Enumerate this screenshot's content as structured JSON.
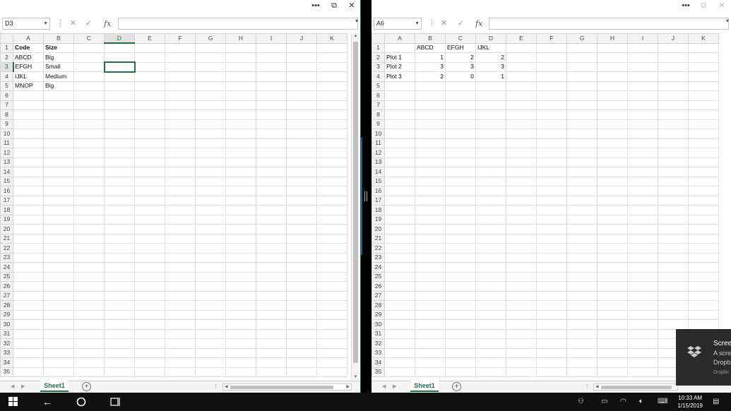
{
  "left_window": {
    "titlebar": {
      "more": "•••",
      "restore": "⧉",
      "close": "✕"
    },
    "namebox": "D3",
    "formula_value": "",
    "fx": "fx",
    "columns": [
      "A",
      "B",
      "C",
      "D",
      "E",
      "F",
      "G",
      "H",
      "I",
      "J",
      "K"
    ],
    "selected_column": "D",
    "selected_row": 3,
    "rows": [
      [
        "Code",
        "Size",
        "",
        "",
        "",
        "",
        "",
        "",
        "",
        "",
        ""
      ],
      [
        "ABCD",
        "Big",
        "",
        "",
        "",
        "",
        "",
        "",
        "",
        "",
        ""
      ],
      [
        "EFGH",
        "Small",
        "",
        "",
        "",
        "",
        "",
        "",
        "",
        "",
        ""
      ],
      [
        "IJKL",
        "Medium",
        "",
        "",
        "",
        "",
        "",
        "",
        "",
        "",
        ""
      ],
      [
        "MNOP",
        "Big",
        "",
        "",
        "",
        "",
        "",
        "",
        "",
        "",
        ""
      ]
    ],
    "row_count": 35,
    "sheet_tab": "Sheet1",
    "add_sheet": "+"
  },
  "right_window": {
    "titlebar": {
      "more": "•••",
      "restore": "⧉",
      "close": "✕"
    },
    "namebox": "A6",
    "formula_value": "",
    "fx": "fx",
    "columns": [
      "A",
      "B",
      "C",
      "D",
      "E",
      "F",
      "G",
      "H",
      "I",
      "J",
      "K"
    ],
    "rows": [
      [
        "",
        "ABCD",
        "EFGH",
        "IJKL",
        "",
        "",
        "",
        "",
        "",
        "",
        ""
      ],
      [
        "Plot 1",
        "1",
        "2",
        "2",
        "",
        "",
        "",
        "",
        "",
        "",
        ""
      ],
      [
        "Plot 2",
        "3",
        "3",
        "3",
        "",
        "",
        "",
        "",
        "",
        "",
        ""
      ],
      [
        "Plot 3",
        "2",
        "0",
        "1",
        "",
        "",
        "",
        "",
        "",
        "",
        ""
      ]
    ],
    "row_count": 35,
    "sheet_tab": "Sheet1",
    "add_sheet": "+"
  },
  "toast": {
    "title": "Scree",
    "line1": "A scre",
    "line2": "Dropb",
    "source": "Dropbc"
  },
  "taskbar": {
    "time": "10:33 AM",
    "date": "1/15/2019",
    "start_icon": "windows-logo-icon",
    "back_icon": "back-arrow-icon",
    "cortana_icon": "cortana-circle-icon",
    "taskview_icon": "task-view-icon"
  },
  "colors": {
    "excel_green": "#1e7145",
    "taskbar": "#101010",
    "toast": "#2b2b2b"
  }
}
